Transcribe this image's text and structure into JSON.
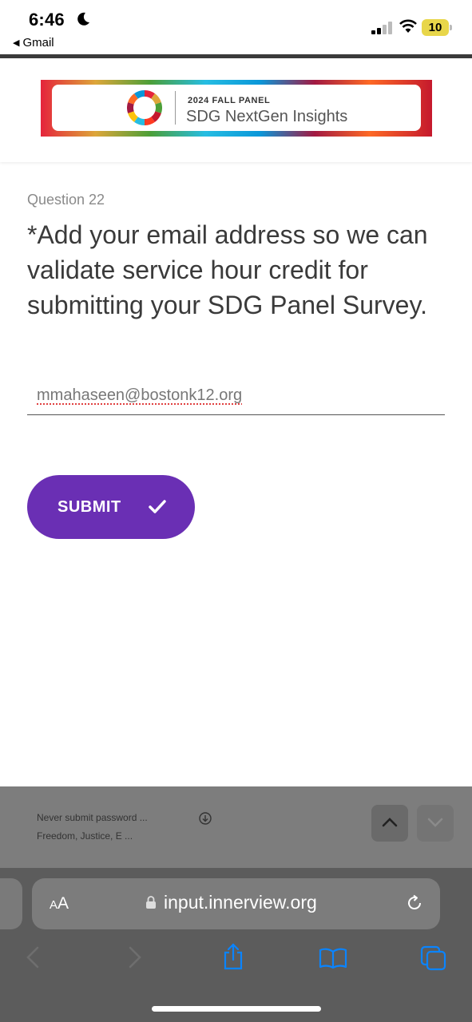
{
  "status_bar": {
    "time": "6:46",
    "back_app": "Gmail",
    "battery": "10",
    "battery_color": "#e8d64a"
  },
  "header": {
    "banner_kicker": "2024 FALL PANEL",
    "banner_title": "SDG NextGen Insights"
  },
  "question": {
    "number_label": "Question 22",
    "text": "*Add your email address so we can validate service hour credit for submitting your SDG Panel Survey."
  },
  "email_field": {
    "value": "mmahaseen@bostonk12.org"
  },
  "submit": {
    "label": "SUBMIT",
    "color": "#6a2fb4"
  },
  "suggestions": {
    "line1": "Never submit password  ...",
    "line2": "Freedom, Justice, E ..."
  },
  "safari": {
    "aa_small": "A",
    "aa_big": "A",
    "url": "input.innerview.org",
    "toolbar_icons": [
      "back-icon",
      "forward-icon",
      "share-icon",
      "bookmarks-icon",
      "tabs-icon"
    ],
    "accent": "#0a84ff"
  }
}
